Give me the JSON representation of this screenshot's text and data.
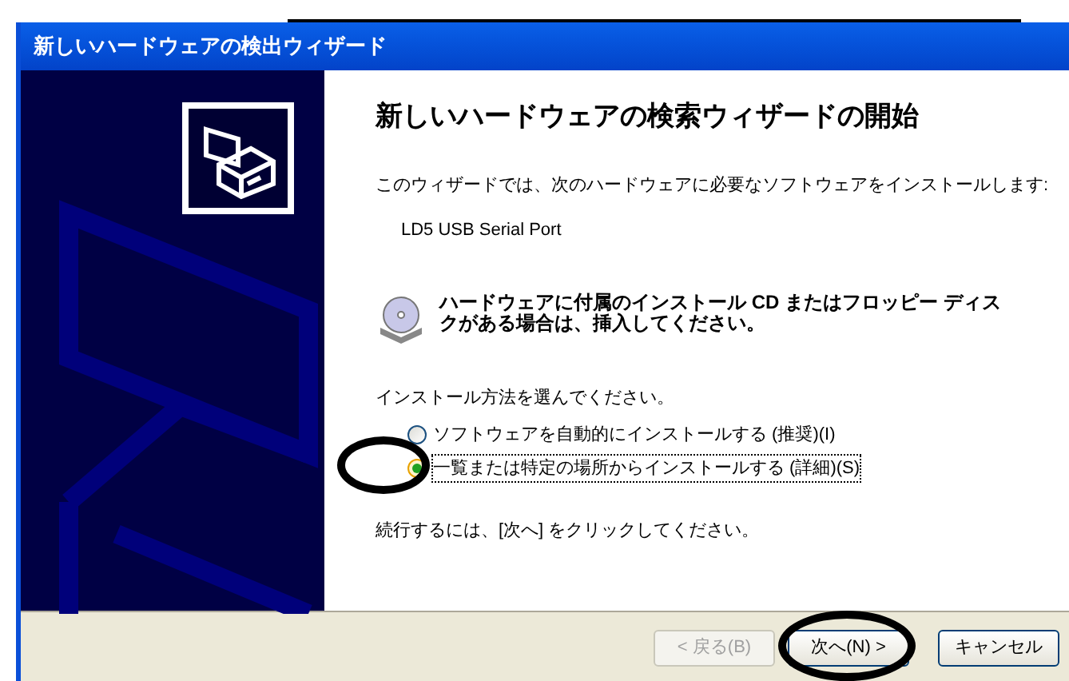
{
  "window": {
    "title": "新しいハードウェアの検出ウィザード"
  },
  "heading": "新しいハードウェアの検索ウィザードの開始",
  "intro": "このウィザードでは、次のハードウェアに必要なソフトウェアをインストールします:",
  "device": "LD5 USB Serial Port",
  "cd_notice": "ハードウェアに付属のインストール CD またはフロッピー ディスクがある場合は、挿入してください。",
  "prompt": "インストール方法を選んでください。",
  "options": [
    {
      "label": "ソフトウェアを自動的にインストールする (推奨)(I)",
      "selected": false,
      "circled": false
    },
    {
      "label": "一覧または特定の場所からインストールする (詳細)(S)",
      "selected": true,
      "circled": true
    }
  ],
  "continue_text": "続行するには、[次へ] をクリックしてください。",
  "buttons": [
    {
      "label": "< 戻る(B)",
      "disabled": true,
      "circled": false
    },
    {
      "label": "次へ(N) >",
      "disabled": false,
      "circled": true
    },
    {
      "label": "キャンセル",
      "disabled": false,
      "circled": false
    }
  ]
}
